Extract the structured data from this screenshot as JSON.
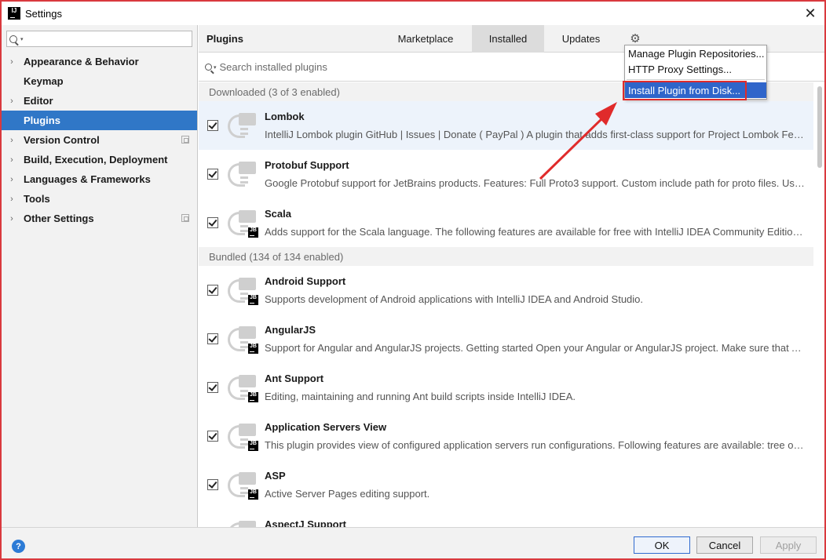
{
  "window": {
    "title": "Settings",
    "app_icon": "IJ",
    "close": "✕"
  },
  "sidebar": {
    "search_placeholder": "",
    "items": [
      {
        "label": "Appearance & Behavior",
        "expandable": true,
        "selected": false,
        "project_icon": false
      },
      {
        "label": "Keymap",
        "expandable": false,
        "selected": false,
        "project_icon": false
      },
      {
        "label": "Editor",
        "expandable": true,
        "selected": false,
        "project_icon": false
      },
      {
        "label": "Plugins",
        "expandable": false,
        "selected": true,
        "project_icon": false
      },
      {
        "label": "Version Control",
        "expandable": true,
        "selected": false,
        "project_icon": true
      },
      {
        "label": "Build, Execution, Deployment",
        "expandable": true,
        "selected": false,
        "project_icon": false
      },
      {
        "label": "Languages & Frameworks",
        "expandable": true,
        "selected": false,
        "project_icon": false
      },
      {
        "label": "Tools",
        "expandable": true,
        "selected": false,
        "project_icon": false
      },
      {
        "label": "Other Settings",
        "expandable": true,
        "selected": false,
        "project_icon": true
      }
    ]
  },
  "main": {
    "title": "Plugins",
    "tabs": [
      {
        "label": "Marketplace",
        "active": false
      },
      {
        "label": "Installed",
        "active": true
      },
      {
        "label": "Updates",
        "active": false
      }
    ],
    "gear_icon": "⚙",
    "search_placeholder": "Search installed plugins"
  },
  "groups": [
    {
      "header": "Downloaded (3 of 3 enabled)",
      "plugins": [
        {
          "name": "Lombok",
          "desc": "IntelliJ Lombok plugin GitHub | Issues | Donate ( PayPal ) A plugin that adds first-class support for Project Lombok Features @Getter and",
          "checked": true,
          "jb": false,
          "highlight": true
        },
        {
          "name": "Protobuf Support",
          "desc": "Google Protobuf support for JetBrains products. Features: Full Proto3 support. Custom include path for proto files. Usage Install",
          "checked": true,
          "jb": false,
          "highlight": false
        },
        {
          "name": "Scala",
          "desc": "Adds support for the Scala language. The following features are available for free with IntelliJ IDEA Community Edition: Coding",
          "checked": true,
          "jb": true,
          "highlight": false
        }
      ]
    },
    {
      "header": "Bundled (134 of 134 enabled)",
      "plugins": [
        {
          "name": "Android Support",
          "desc": "Supports development of Android applications with IntelliJ IDEA and Android Studio.",
          "checked": true,
          "jb": true,
          "highlight": false
        },
        {
          "name": "AngularJS",
          "desc": "Support for Angular and AngularJS projects. Getting started Open your Angular or AngularJS project. Make sure that AngularJS",
          "checked": true,
          "jb": true,
          "highlight": false
        },
        {
          "name": "Ant Support",
          "desc": "Editing, maintaining and running Ant build scripts inside IntelliJ IDEA.",
          "checked": true,
          "jb": true,
          "highlight": false
        },
        {
          "name": "Application Servers View",
          "desc": "This plugin provides view of configured application servers run configurations. Following features are available: tree of all",
          "checked": true,
          "jb": true,
          "highlight": false
        },
        {
          "name": "ASP",
          "desc": "Active Server Pages editing support.",
          "checked": true,
          "jb": true,
          "highlight": false
        },
        {
          "name": "AspectJ Support",
          "desc": "",
          "checked": true,
          "jb": true,
          "highlight": false
        }
      ]
    }
  ],
  "menu": {
    "items": [
      {
        "label": "Manage Plugin Repositories...",
        "selected": false
      },
      {
        "label": "HTTP Proxy Settings...",
        "selected": false
      },
      {
        "label": "Install Plugin from Disk...",
        "selected": true
      }
    ]
  },
  "footer": {
    "help": "?",
    "ok": "OK",
    "cancel": "Cancel",
    "apply": "Apply"
  },
  "colors": {
    "accent": "#3077c7",
    "menu_selected": "#2f65ca",
    "annotation": "#e02b2b"
  }
}
